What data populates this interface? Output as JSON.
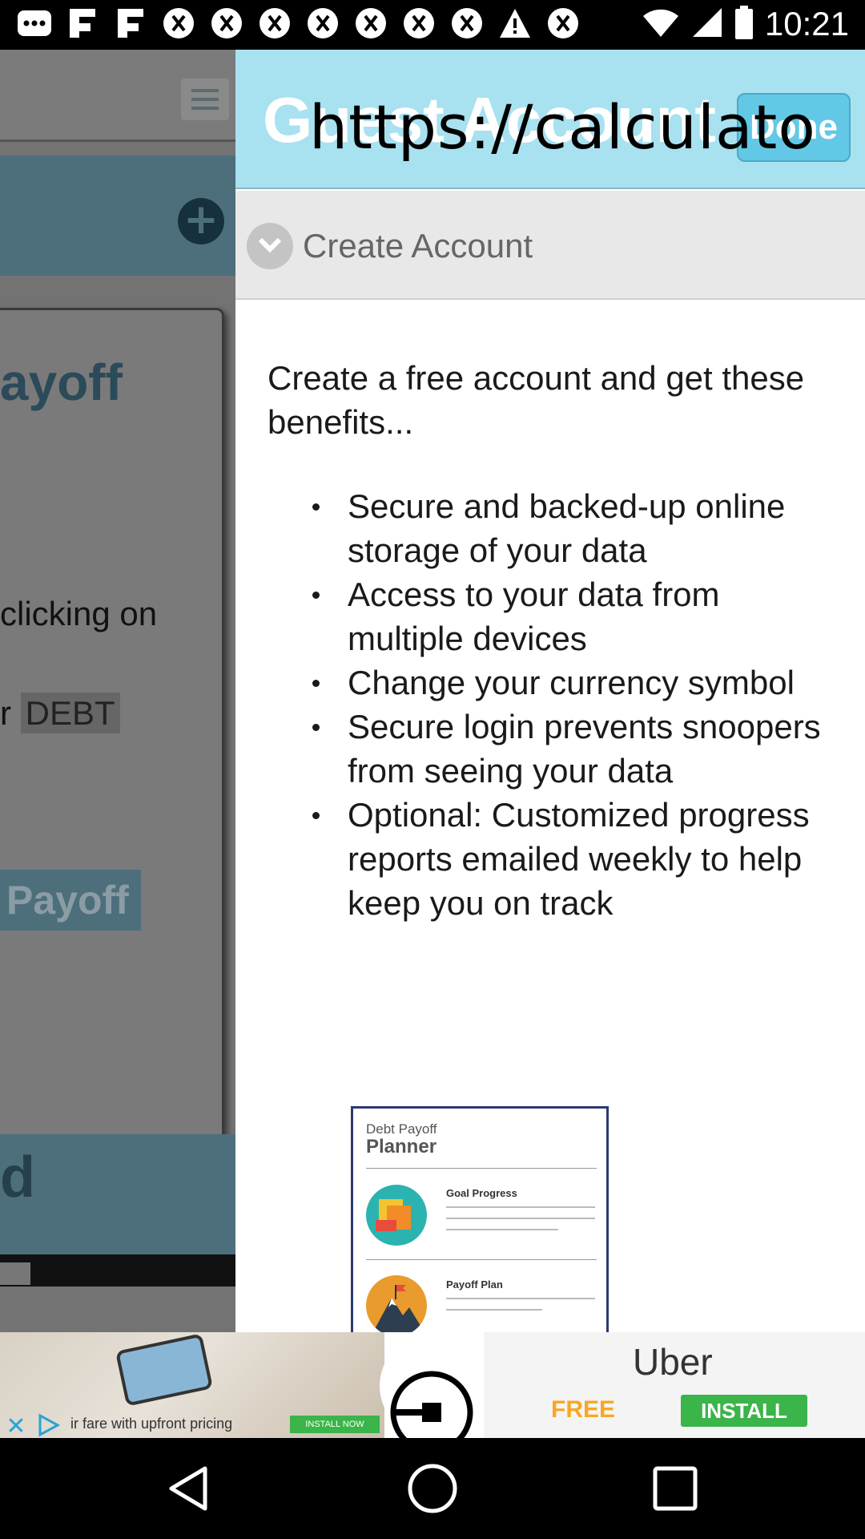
{
  "status_bar": {
    "time": "10:21",
    "left_icons": [
      "message-dots-icon",
      "flipboard-icon",
      "flipboard-icon",
      "currency-icon",
      "currency-icon",
      "currency-icon",
      "currency-icon",
      "currency-icon",
      "currency-icon",
      "currency-icon",
      "currency-icon",
      "warning-icon",
      "currency-icon"
    ]
  },
  "background_app": {
    "title_fragment": "ayoff",
    "text_fragment_1": "clicking on",
    "text_fragment_2_prefix": "r ",
    "debt_chip": "DEBT",
    "payoff_button": "Payoff",
    "bottom_fragment": "d"
  },
  "panel": {
    "header_title": "Guest Account",
    "done_label": "Done",
    "url_overlay": "https://calculato",
    "section_label": "Create Account",
    "intro": "Create a free account and get these benefits...",
    "benefits": [
      "Secure and backed-up online storage of your data",
      "Access to your data from multiple devices",
      "Change your currency symbol",
      "Secure login prevents snoopers from seeing your data",
      "Optional: Customized progress reports emailed weekly to help keep you on track"
    ],
    "preview": {
      "brand_line1": "Debt Payoff",
      "brand_line2": "Planner",
      "heading1": "Goal Progress",
      "heading2": "Payoff Plan"
    }
  },
  "ad": {
    "caption": "ir fare with upfront pricing",
    "small_install": "INSTALL NOW",
    "brand": "Uber",
    "free_label": "FREE",
    "install_label": "INSTALL"
  },
  "colors": {
    "header_bg": "#a8e1ef",
    "done_bg": "#63c8e6",
    "install_green": "#3bb44a",
    "free_orange": "#f7a823"
  }
}
